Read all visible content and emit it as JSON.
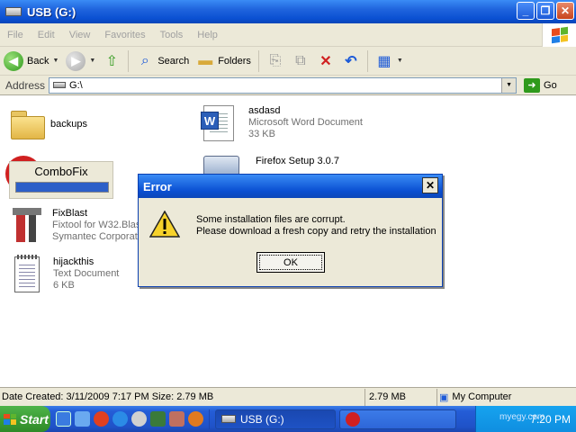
{
  "window": {
    "title": "USB (G:)"
  },
  "menu": [
    "File",
    "Edit",
    "View",
    "Favorites",
    "Tools",
    "Help"
  ],
  "toolbar": {
    "back_label": "Back",
    "search_label": "Search",
    "folders_label": "Folders"
  },
  "address": {
    "label": "Address",
    "value": "G:\\",
    "go_label": "Go"
  },
  "files": [
    {
      "name": "backups",
      "type": "",
      "size": ""
    },
    {
      "name": "asdasd",
      "type": "Microsoft Word Document",
      "size": "33 KB"
    },
    {
      "name": "Firefox Setup 3.0.7",
      "type": "",
      "size": ""
    },
    {
      "name": "FixBlast",
      "type": "Fixtool for W32.Blas",
      "size": "Symantec Corporat"
    },
    {
      "name": "hijackthis",
      "type": "Text Document",
      "size": "6 KB"
    }
  ],
  "combofix": {
    "title": "ComboFix",
    "progress": 1.0
  },
  "dialog": {
    "title": "Error",
    "line1": "Some installation files are corrupt.",
    "line2": "Please download a fresh copy and retry the installation",
    "ok_label": "OK"
  },
  "status": {
    "info": "Date Created: 3/11/2009 7:17 PM Size: 2.79 MB",
    "size": "2.79 MB",
    "location": "My Computer"
  },
  "taskbar": {
    "start_label": "Start",
    "task_label": "USB (G:)",
    "time": "7:20 PM",
    "tray_overlay": "myegy.com"
  }
}
